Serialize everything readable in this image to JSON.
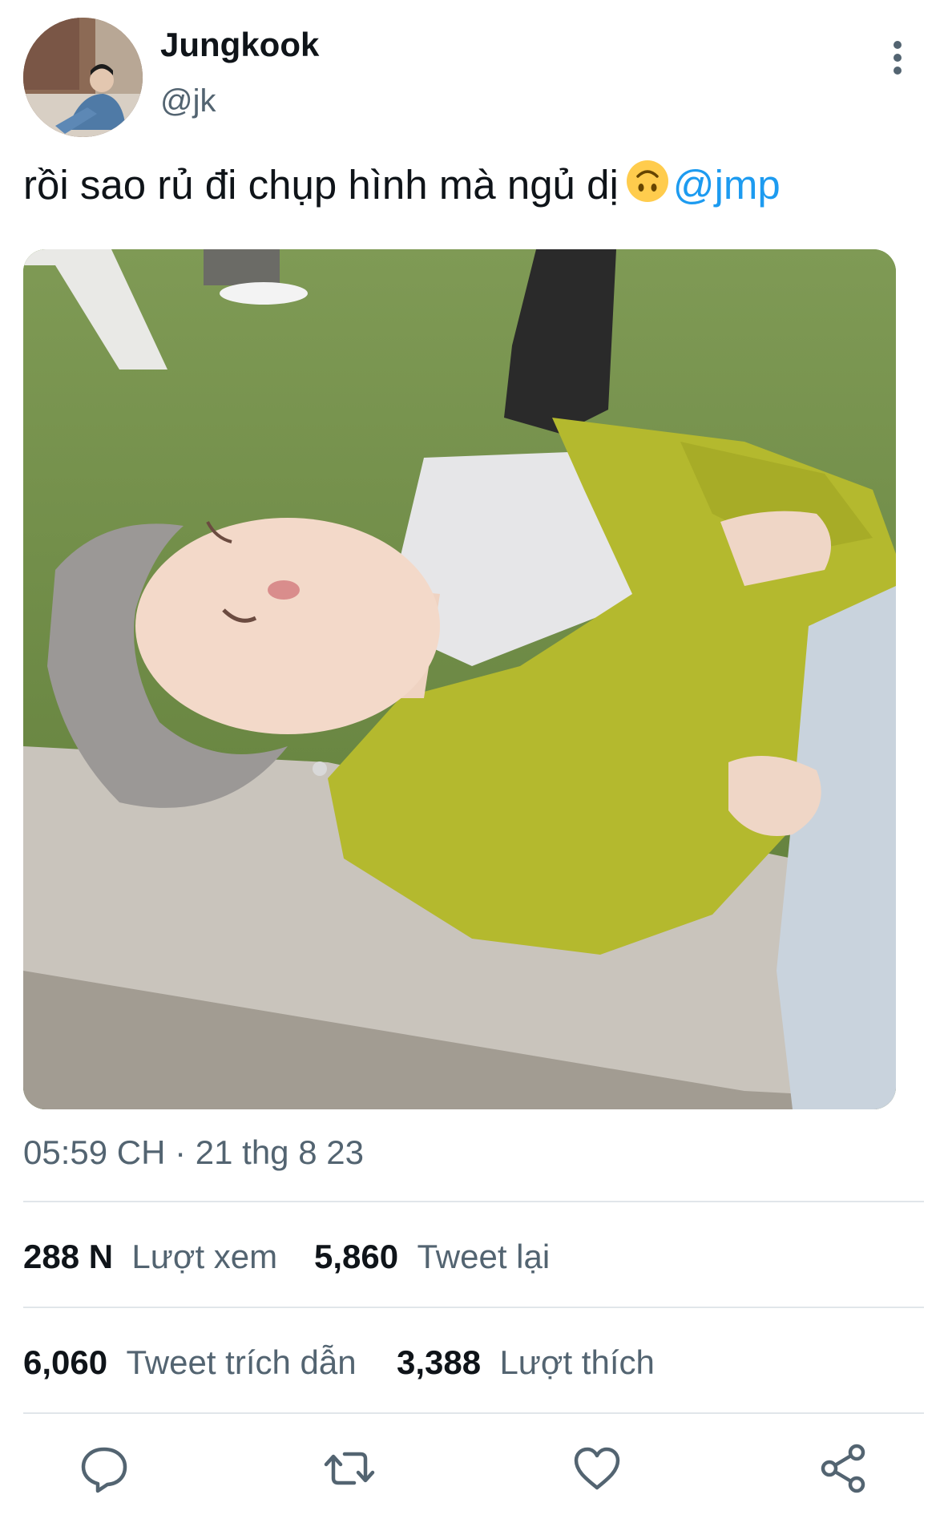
{
  "header": {
    "display_name": "Jungkook",
    "handle": "@jk",
    "more_icon": "more-vertical-icon"
  },
  "tweet": {
    "text": "rồi sao rủ đi chụp hình mà ngủ dị",
    "emoji": "upside-down-face-emoji",
    "mention": "@jmp"
  },
  "media": {
    "description_icon": "photo"
  },
  "timestamp": "05:59 CH · 21 thg 8 23",
  "stats": {
    "views_value": "288 N",
    "views_label": "Lượt xem",
    "retweets_value": "5,860",
    "retweets_label": "Tweet lại",
    "quotes_value": "6,060",
    "quotes_label": "Tweet trích dẫn",
    "likes_value": "3,388",
    "likes_label": "Lượt thích"
  },
  "actions": [
    "reply-icon",
    "retweet-icon",
    "like-icon",
    "share-icon"
  ],
  "colors": {
    "mention": "#1d9bf0",
    "secondary_text": "#536471",
    "icon": "#536471"
  }
}
